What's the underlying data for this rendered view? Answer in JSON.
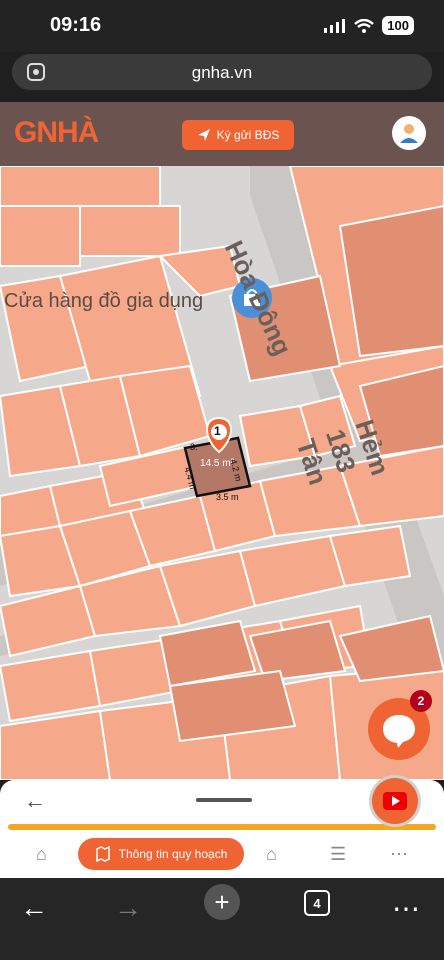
{
  "status_bar": {
    "time": "09:16",
    "battery": "100"
  },
  "browser": {
    "url": "gnha.vn",
    "tab_count": "4"
  },
  "header": {
    "logo": "GNHÀ",
    "consign_button_label": "Ký gửi BĐS"
  },
  "map": {
    "poi_label": "Cửa hàng đồ gia dụng",
    "street_label_top": "Hòa Đông",
    "street_label_right": "Hẻm 183 Tân",
    "parcel": {
      "number": "1",
      "area": "14.5 m²",
      "side_top": "3.",
      "side_right": "4.2 m",
      "side_left": "4.4 m",
      "side_bottom": "3.5 m"
    }
  },
  "chat": {
    "badge_count": "2"
  },
  "bottom_nav": {
    "planning_info_label": "Thông tin quy hoạch"
  }
}
